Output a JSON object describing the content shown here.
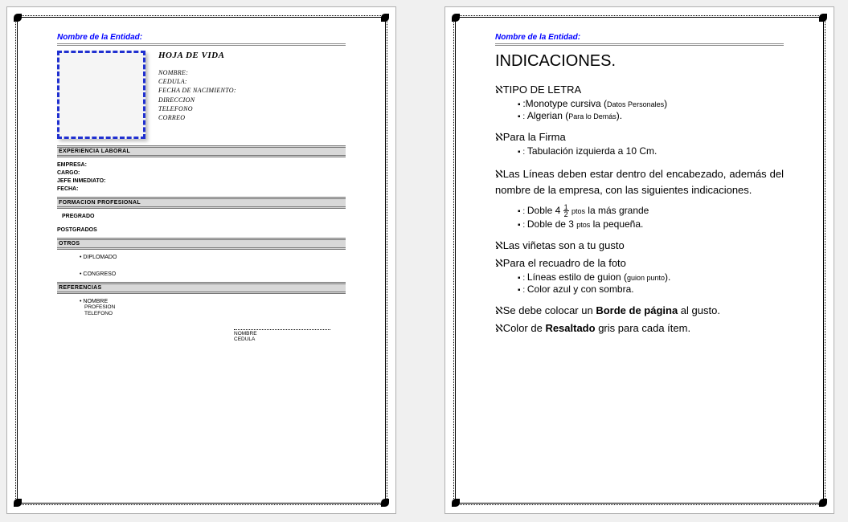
{
  "entity_label": "Nombre de la Entidad:",
  "page1": {
    "title": "HOJA DE VIDA",
    "personal": {
      "nombre": "NOMBRE:",
      "cedula": "CEDULA:",
      "fecha_nac": "FECHA DE NACIMIENTO:",
      "direccion": "DIRECCION",
      "telefono": "TELEFONO",
      "correo": "CORREO"
    },
    "sec_exp": "EXPERIENCIA LABORAL",
    "exp": {
      "empresa": "EMPRESA:",
      "cargo": "CARGO:",
      "jefe": "JEFE INMEDIATO:",
      "fecha": "FECHA:"
    },
    "sec_form": "FORMACION PROFESIONAL",
    "form": {
      "pregrado": "PREGRADO",
      "postgrados": "POSTGRADOS"
    },
    "sec_otros": "OTROS",
    "otros": {
      "diplomado": "DIPLOMADO",
      "congreso": "CONGRESO"
    },
    "sec_ref": "REFERENCIAS",
    "ref": {
      "nombre": "NOMBRE",
      "profesion": "PROFESION",
      "telefono": "TELEFONO"
    },
    "sig": {
      "nombre": "NOMBRE",
      "cedula": "CEDULA"
    }
  },
  "page2": {
    "heading": "INDICACIONES.",
    "tipo_letra": "TIPO DE LETRA",
    "tl_1a": ":Monotype cursiva (",
    "tl_1b": "Datos Personales",
    "tl_1c": ")",
    "tl_2a": "Algerian (",
    "tl_2b": "Para lo Demás",
    "tl_2c": ").",
    "firma_t": "Para la Firma",
    "firma_1": "Tabulación izquierda a 10 Cm.",
    "lineas": "Las Líneas deben estar dentro del encabezado, además del nombre de la empresa, con las siguientes indicaciones.",
    "lin_1a": "Doble 4 ",
    "lin_1b": " la más grande",
    "lin_2a": "Doble de 3 ",
    "lin_2b": " la pequeña.",
    "ptos": "ptos",
    "vinetas": "Las viñetas son a tu gusto",
    "recuadro": "Para el recuadro de la foto",
    "rec_1a": "Líneas estilo de guion (",
    "rec_1b": "guion punto",
    "rec_1c": ").",
    "rec_2": "Color azul y con sombra.",
    "borde_a": "Se debe colocar un ",
    "borde_b": "Borde de página",
    "borde_c": " al gusto.",
    "res_a": "Color de ",
    "res_b": "Resaltado",
    "res_c": " gris para cada ítem."
  }
}
